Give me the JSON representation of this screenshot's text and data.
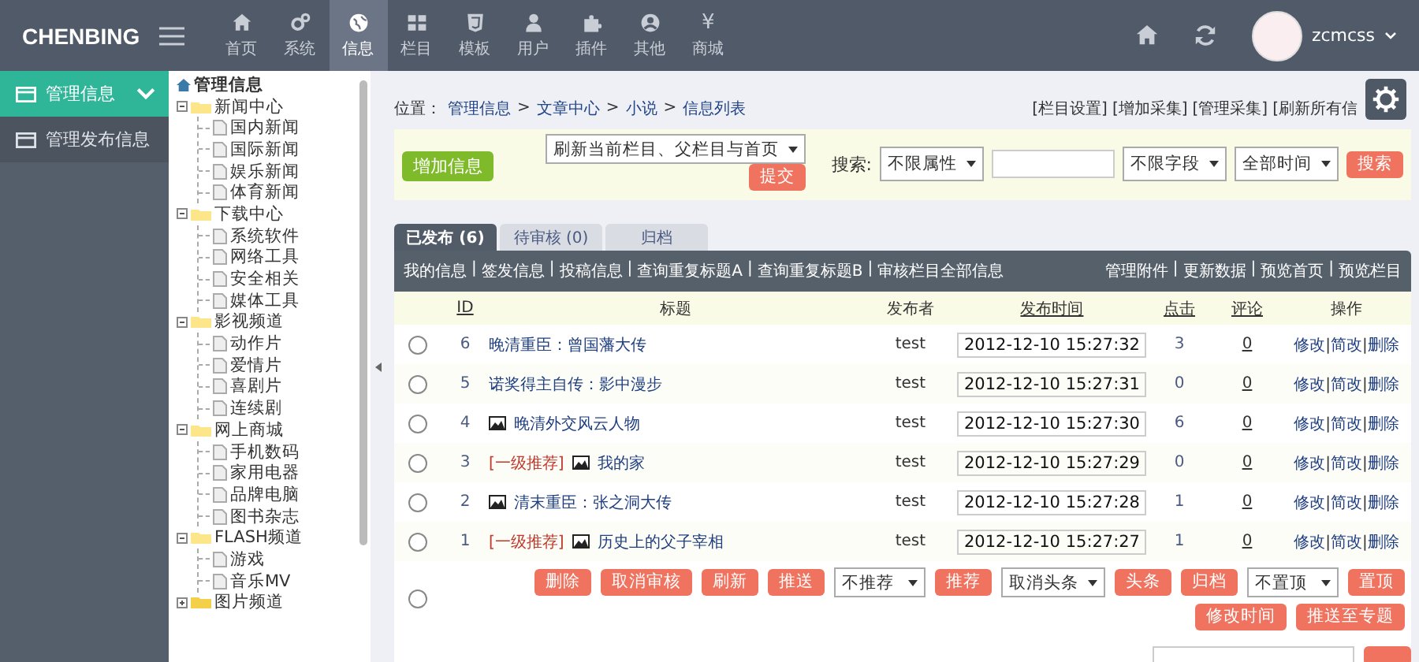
{
  "topbar": {
    "brand": "CHENBING",
    "nav": [
      {
        "label": "首页",
        "selected": false
      },
      {
        "label": "系统",
        "selected": false
      },
      {
        "label": "信息",
        "selected": true
      },
      {
        "label": "栏目",
        "selected": false
      },
      {
        "label": "模板",
        "selected": false
      },
      {
        "label": "用户",
        "selected": false
      },
      {
        "label": "插件",
        "selected": false
      },
      {
        "label": "其他",
        "selected": false
      },
      {
        "label": "商城",
        "selected": false,
        "glyph": "¥"
      }
    ],
    "user": "zcmcss"
  },
  "sidebar": {
    "items": [
      {
        "label": "管理信息",
        "selected": true
      },
      {
        "label": "管理发布信息",
        "selected": false
      }
    ]
  },
  "tree": {
    "label": "管理信息",
    "children": [
      {
        "label": "新闻中心",
        "expanded": true,
        "children": [
          {
            "label": "国内新闻"
          },
          {
            "label": "国际新闻"
          },
          {
            "label": "娱乐新闻"
          },
          {
            "label": "体育新闻"
          }
        ]
      },
      {
        "label": "下载中心",
        "expanded": true,
        "children": [
          {
            "label": "系统软件"
          },
          {
            "label": "网络工具"
          },
          {
            "label": "安全相关"
          },
          {
            "label": "媒体工具"
          }
        ]
      },
      {
        "label": "影视频道",
        "expanded": true,
        "children": [
          {
            "label": "动作片"
          },
          {
            "label": "爱情片"
          },
          {
            "label": "喜剧片"
          },
          {
            "label": "连续剧"
          }
        ]
      },
      {
        "label": "网上商城",
        "expanded": true,
        "children": [
          {
            "label": "手机数码"
          },
          {
            "label": "家用电器"
          },
          {
            "label": "品牌电脑"
          },
          {
            "label": "图书杂志"
          }
        ]
      },
      {
        "label": "FLASH频道",
        "expanded": true,
        "children": [
          {
            "label": "游戏"
          },
          {
            "label": "音乐MV"
          }
        ]
      },
      {
        "label": "图片频道",
        "expanded": false
      }
    ]
  },
  "breadcrumb": {
    "label": "位置：",
    "separator": ">",
    "path": [
      "管理信息",
      "文章中心",
      "小说",
      "信息列表"
    ],
    "links": [
      "[栏目设置]",
      "[增加采集]",
      "[管理采集]",
      "[刷新所有信"
    ]
  },
  "toolbar": {
    "add_button": "增加信息",
    "refresh_select": "刷新当前栏目、父栏目与首页",
    "submit_button": "提交",
    "search_label": "搜索:",
    "attribute_select": "不限属性",
    "field_select": "不限字段",
    "time_select": "全部时间",
    "search_button": "搜索"
  },
  "tabs": [
    {
      "label": "已发布 (6)",
      "selected": true
    },
    {
      "label": "待审核 (0)",
      "selected": false
    },
    {
      "label": "归档",
      "selected": false
    }
  ],
  "link_bar": {
    "separator": "|",
    "left": [
      "我的信息",
      "签发信息",
      "投稿信息",
      "查询重复标题A",
      "查询重复标题B",
      "审核栏目全部信息"
    ],
    "right": [
      "管理附件",
      "更新数据",
      "预览首页",
      "预览栏目"
    ]
  },
  "table": {
    "columns": [
      {
        "label": "ID",
        "link": true
      },
      {
        "label": "标题",
        "link": false
      },
      {
        "label": "发布者",
        "link": false
      },
      {
        "label": "发布时间",
        "link": true
      },
      {
        "label": "点击",
        "link": true
      },
      {
        "label": "评论",
        "link": true
      },
      {
        "label": "操作",
        "link": false
      }
    ],
    "rows": [
      {
        "selected": false,
        "id": "6",
        "image": false,
        "title": "晚清重臣：曾国藩大传",
        "author": "test",
        "time": "2012-12-10 15:27:32",
        "clicks": "3",
        "comments": "0",
        "actions": [
          "修改",
          "简改",
          "删除"
        ]
      },
      {
        "selected": false,
        "id": "5",
        "image": false,
        "title": "诺奖得主自传：影中漫步",
        "author": "test",
        "time": "2012-12-10 15:27:31",
        "clicks": "0",
        "comments": "0",
        "actions": [
          "修改",
          "简改",
          "删除"
        ]
      },
      {
        "selected": false,
        "id": "4",
        "image": true,
        "title": "晚清外交风云人物",
        "author": "test",
        "time": "2012-12-10 15:27:30",
        "clicks": "6",
        "comments": "0",
        "actions": [
          "修改",
          "简改",
          "删除"
        ]
      },
      {
        "selected": false,
        "id": "3",
        "tag": "[一级推荐]",
        "image": true,
        "title": "我的家",
        "author": "test",
        "time": "2012-12-10 15:27:29",
        "clicks": "0",
        "comments": "0",
        "actions": [
          "修改",
          "简改",
          "删除"
        ]
      },
      {
        "selected": false,
        "id": "2",
        "image": true,
        "title": "清末重臣：张之洞大传",
        "author": "test",
        "time": "2012-12-10 15:27:28",
        "clicks": "1",
        "comments": "0",
        "actions": [
          "修改",
          "简改",
          "删除"
        ]
      },
      {
        "selected": false,
        "id": "1",
        "tag": "[一级推荐]",
        "image": true,
        "title": "历史上的父子宰相",
        "author": "test",
        "time": "2012-12-10 15:27:27",
        "clicks": "1",
        "comments": "0",
        "actions": [
          "修改",
          "简改",
          "删除"
        ]
      }
    ]
  },
  "bulk": {
    "select_all": false,
    "controls": [
      {
        "kind": "button",
        "label": "删除"
      },
      {
        "kind": "button",
        "label": "取消审核"
      },
      {
        "kind": "button",
        "label": "刷新"
      },
      {
        "kind": "button",
        "label": "推送"
      },
      {
        "kind": "select",
        "label": "不推荐"
      },
      {
        "kind": "button",
        "label": "推荐"
      },
      {
        "kind": "select",
        "label": "取消头条"
      },
      {
        "kind": "button",
        "label": "头条"
      },
      {
        "kind": "button",
        "label": "归档"
      },
      {
        "kind": "select",
        "label": "不置顶"
      },
      {
        "kind": "button",
        "label": "置顶"
      },
      {
        "kind": "button",
        "label": "修改时间"
      },
      {
        "kind": "button",
        "label": "推送至专题"
      }
    ]
  }
}
